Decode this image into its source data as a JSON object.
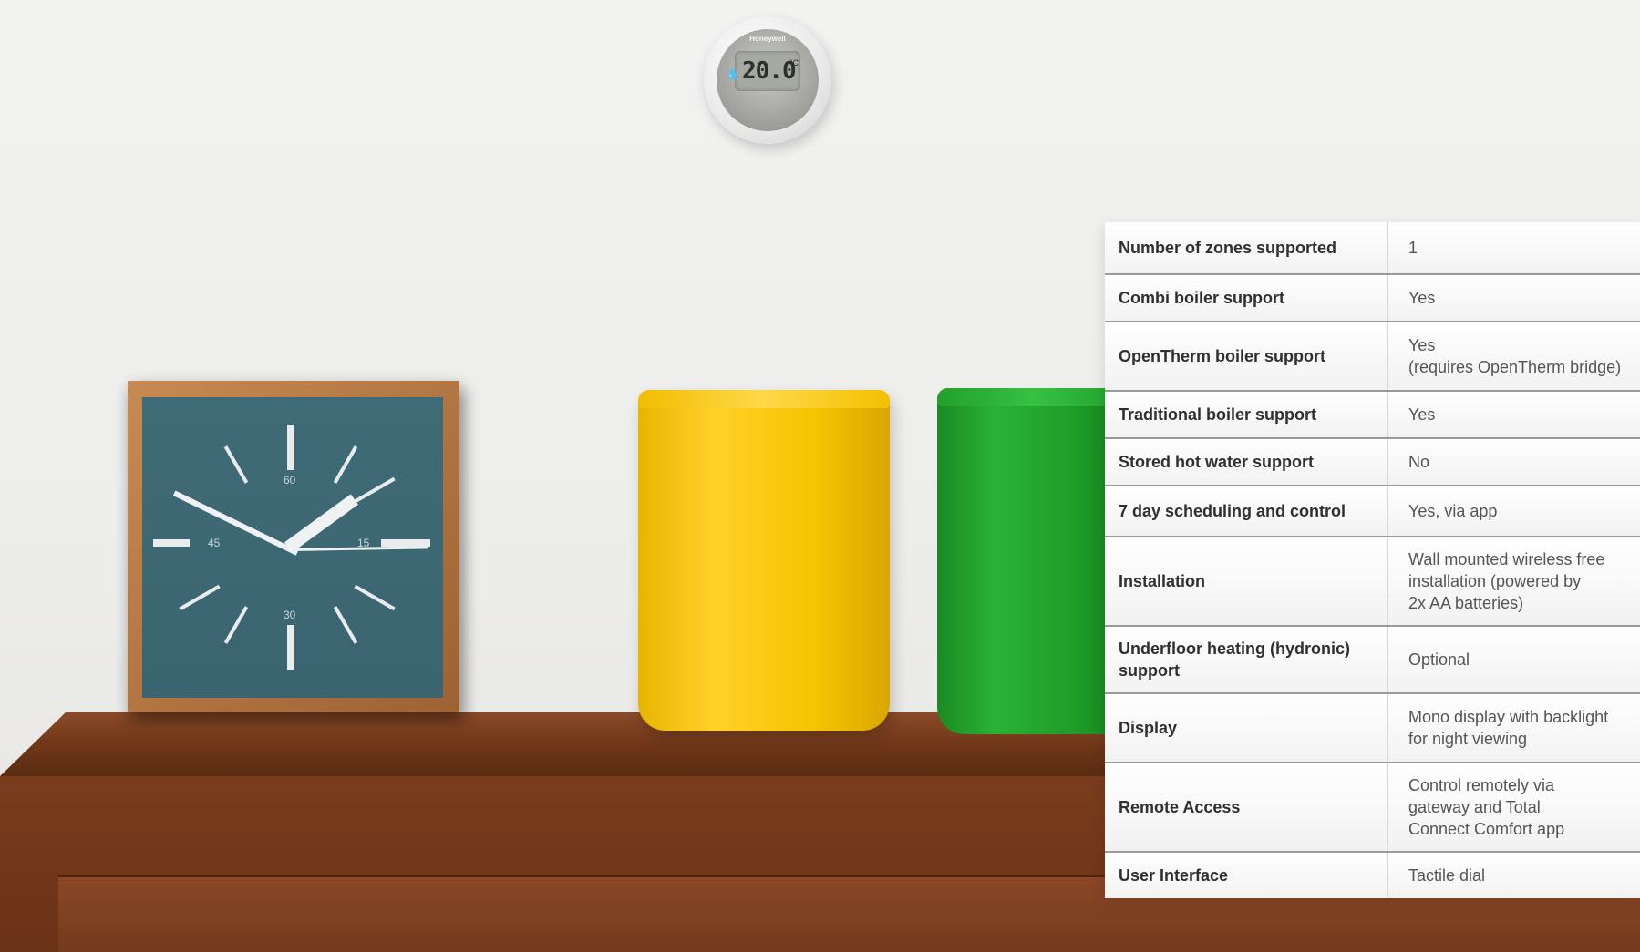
{
  "thermostat": {
    "brand": "Honeywell",
    "display_temperature": "20.0",
    "display_unit": "°C"
  },
  "clock": {
    "numerals": [
      "60",
      "15",
      "30",
      "45"
    ]
  },
  "specs": [
    {
      "label": "Number of zones supported",
      "value": "1"
    },
    {
      "label": "Combi boiler support",
      "value": "Yes"
    },
    {
      "label": "OpenTherm boiler support",
      "value": "Yes\n(requires OpenTherm bridge)"
    },
    {
      "label": "Traditional boiler support",
      "value": "Yes"
    },
    {
      "label": "Stored hot water support",
      "value": "No"
    },
    {
      "label": "7 day scheduling and control",
      "value": "Yes, via app"
    },
    {
      "label": "Installation",
      "value": "Wall mounted wireless free\ninstallation (powered by\n2x AA batteries)"
    },
    {
      "label": "Underfloor heating (hydronic)\nsupport",
      "value": "Optional"
    },
    {
      "label": "Display",
      "value": "Mono display with backlight\nfor night viewing"
    },
    {
      "label": "Remote Access",
      "value": "Control remotely via\ngateway and Total\nConnect Comfort app"
    },
    {
      "label": "User Interface",
      "value": "Tactile dial"
    }
  ]
}
